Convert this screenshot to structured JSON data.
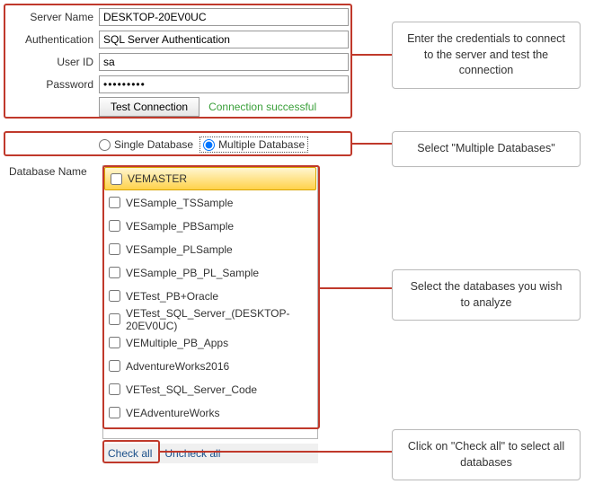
{
  "form": {
    "server_name_label": "Server Name",
    "server_name_value": "DESKTOP-20EV0UC",
    "auth_label": "Authentication",
    "auth_value": "SQL Server Authentication",
    "user_label": "User ID",
    "user_value": "sa",
    "password_label": "Password",
    "password_value": "•••••••••",
    "test_btn": "Test Connection",
    "status": "Connection successful"
  },
  "mode": {
    "single": "Single Database",
    "multiple": "Multiple Database",
    "selected": "multiple"
  },
  "db": {
    "label": "Database Name",
    "items": [
      "VEMASTER",
      "VESample_TSSample",
      "VESample_PBSample",
      "VESample_PLSample",
      "VESample_PB_PL_Sample",
      "VETest_PB+Oracle",
      "VETest_SQL_Server_(DESKTOP-20EV0UC)",
      "VEMultiple_PB_Apps",
      "AdventureWorks2016",
      "VETest_SQL_Server_Code",
      "VEAdventureWorks"
    ],
    "check_all": "Check all",
    "uncheck_all": "Uncheck all"
  },
  "annotations": {
    "creds": "Enter the credentials to connect to the server and test the connection",
    "mode": "Select \"Multiple Databases\"",
    "list": "Select the databases you wish to analyze",
    "checkall": "Click on \"Check all\" to select all databases"
  }
}
